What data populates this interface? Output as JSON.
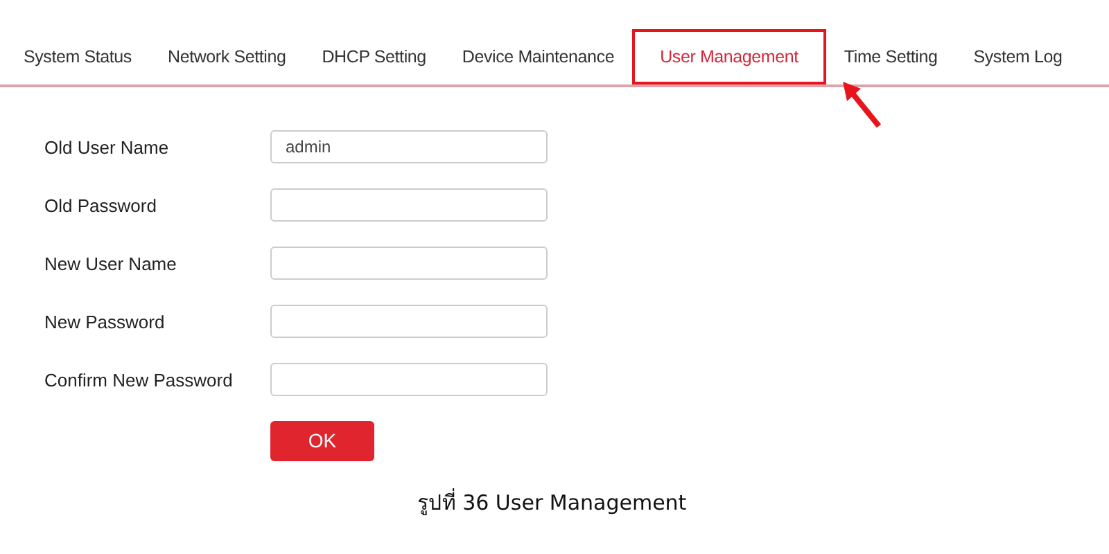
{
  "tabs": [
    {
      "label": "System Status",
      "selected": false
    },
    {
      "label": "Network Setting",
      "selected": false
    },
    {
      "label": "DHCP Setting",
      "selected": false
    },
    {
      "label": "Device Maintenance",
      "selected": false
    },
    {
      "label": "User Management",
      "selected": true
    },
    {
      "label": "Time Setting",
      "selected": false
    },
    {
      "label": "System Log",
      "selected": false
    }
  ],
  "form": {
    "fields": [
      {
        "label": "Old User Name",
        "value": "admin"
      },
      {
        "label": "Old Password"
      },
      {
        "label": "New User Name"
      },
      {
        "label": "New Password"
      },
      {
        "label": "Confirm New Password"
      }
    ],
    "button": "OK"
  },
  "caption": "รูปที่ 36 User Management"
}
